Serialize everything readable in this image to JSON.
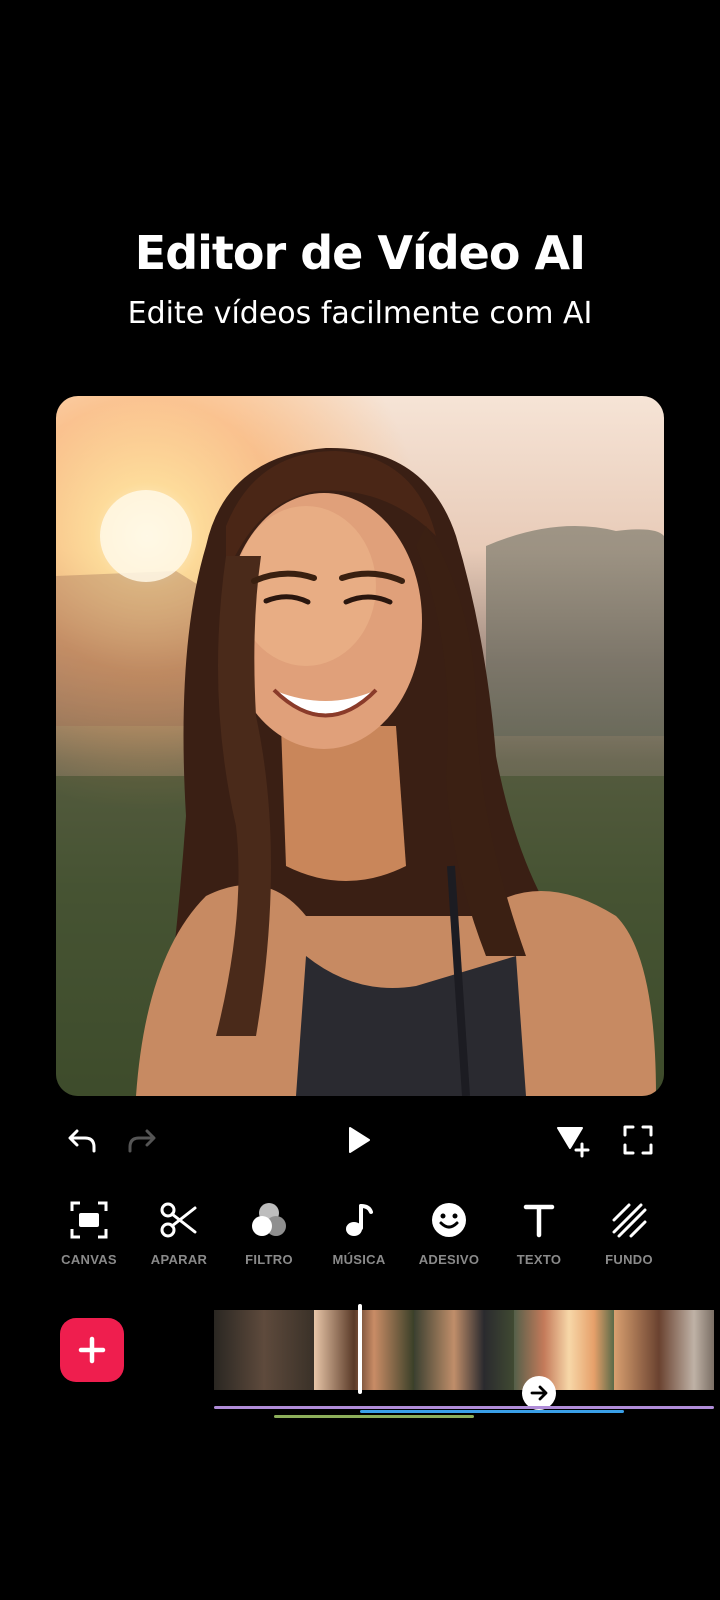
{
  "promo": {
    "title": "Editor de Vídeo AI",
    "subtitle": "Edite vídeos facilmente com AI"
  },
  "preview": {
    "content": "smiling woman with long dark hair at sunset"
  },
  "controls": {
    "undo_icon": "undo-icon",
    "redo_icon": "redo-icon",
    "play_icon": "play-icon",
    "keyframe_icon": "add-keyframe-icon",
    "fullscreen_icon": "fullscreen-icon"
  },
  "tools": [
    {
      "label": "CANVAS",
      "icon": "canvas-icon"
    },
    {
      "label": "APARAR",
      "icon": "scissors-icon"
    },
    {
      "label": "FILTRO",
      "icon": "filter-icon"
    },
    {
      "label": "MÚSICA",
      "icon": "music-note-icon"
    },
    {
      "label": "ADESIVO",
      "icon": "smiley-icon"
    },
    {
      "label": "TEXTO",
      "icon": "text-icon"
    },
    {
      "label": "FUNDO",
      "icon": "background-icon"
    }
  ],
  "timeline": {
    "add_icon": "plus-icon",
    "transition_icon": "arrow-right-icon"
  },
  "colors": {
    "background": "#000000",
    "accent": "#ef1e4e",
    "tool_label": "#8a8a8a",
    "track_purple": "#b08cd8",
    "track_blue": "#3aa0e8",
    "track_green": "#8cae5a"
  }
}
